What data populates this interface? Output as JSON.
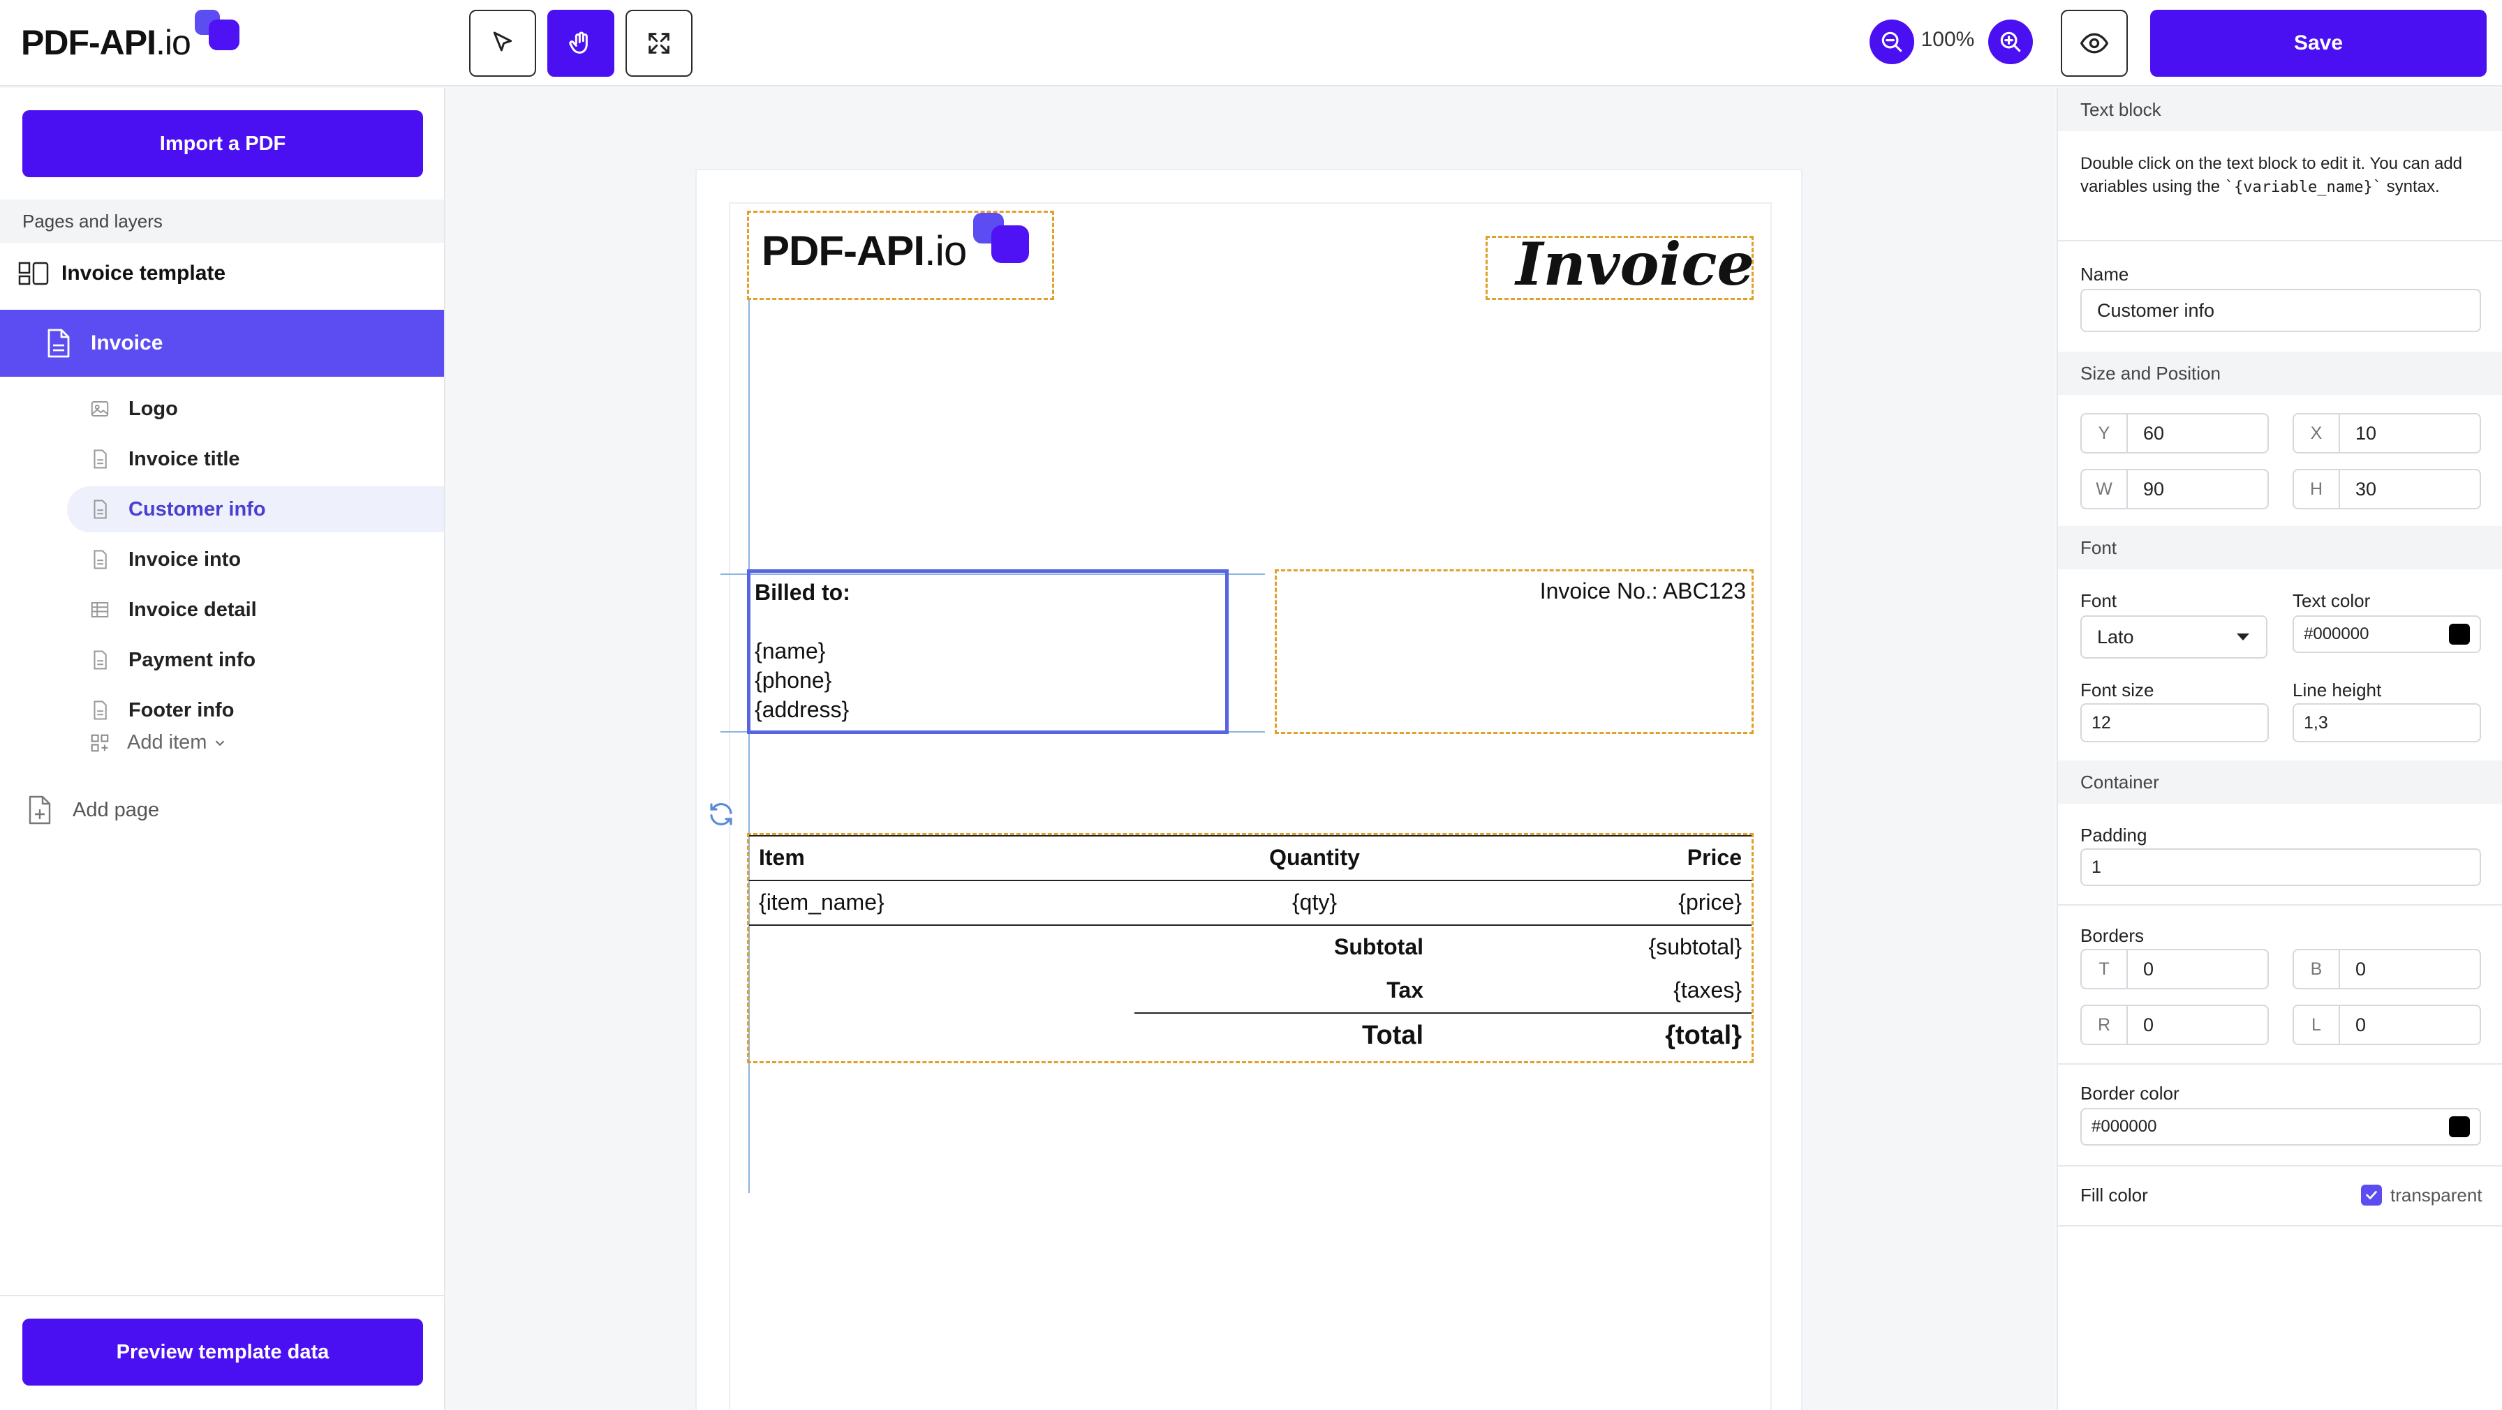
{
  "app": {
    "logo_text": "PDF-API",
    "logo_suffix": ".io"
  },
  "toolbar": {
    "tools": [
      {
        "name": "select",
        "icon": "cursor-icon",
        "active": false
      },
      {
        "name": "pan",
        "icon": "hand-icon",
        "active": true
      },
      {
        "name": "fit",
        "icon": "expand-icon",
        "active": false
      }
    ],
    "zoom_level": "100%",
    "save_label": "Save",
    "accent_color": "#4a10f2"
  },
  "sidebar": {
    "import_label": "Import a PDF",
    "section_title": "Pages and layers",
    "template_name": "Invoice template",
    "page_name": "Invoice",
    "layers": [
      {
        "label": "Logo",
        "icon": "image-icon",
        "selected": false
      },
      {
        "label": "Invoice title",
        "icon": "document-icon",
        "selected": false
      },
      {
        "label": "Customer info",
        "icon": "document-icon",
        "selected": true
      },
      {
        "label": "Invoice into",
        "icon": "document-icon",
        "selected": false
      },
      {
        "label": "Invoice detail",
        "icon": "table-icon",
        "selected": false
      },
      {
        "label": "Payment info",
        "icon": "document-icon",
        "selected": false
      },
      {
        "label": "Footer info",
        "icon": "document-icon",
        "selected": false
      }
    ],
    "add_item_label": "Add item",
    "add_page_label": "Add page",
    "preview_label": "Preview template data"
  },
  "document": {
    "logo_text": "PDF-API",
    "logo_suffix": ".io",
    "title": "Invoice",
    "billed_to_heading": "Billed to:",
    "billed_to_lines": [
      "{name}",
      "{phone}",
      "{address}"
    ],
    "invoice_no": "Invoice No.: ABC123",
    "table": {
      "headers": [
        "Item",
        "Quantity",
        "Price"
      ],
      "row": [
        "{item_name}",
        "{qty}",
        "{price}"
      ],
      "subtotal_label": "Subtotal",
      "subtotal_value": "{subtotal}",
      "tax_label": "Tax",
      "tax_value": "{taxes}",
      "total_label": "Total",
      "total_value": "{total}"
    }
  },
  "properties": {
    "section_text_block": "Text block",
    "help_text_1": "Double click on the text block to edit it. You can add variables using the ",
    "help_code": "`{variable_name}`",
    "help_text_2": " syntax.",
    "name_label": "Name",
    "name_value": "Customer info",
    "section_size": "Size and Position",
    "y_label": "Y",
    "y_value": "60",
    "x_label": "X",
    "x_value": "10",
    "w_label": "W",
    "w_value": "90",
    "h_label": "H",
    "h_value": "30",
    "section_font": "Font",
    "font_label": "Font",
    "font_value": "Lato",
    "text_color_label": "Text color",
    "text_color_value": "#000000",
    "font_size_label": "Font size",
    "font_size_value": "12",
    "line_height_label": "Line height",
    "line_height_value": "1,3",
    "section_container": "Container",
    "padding_label": "Padding",
    "padding_value": "1",
    "borders_label": "Borders",
    "border_t_label": "T",
    "border_t_value": "0",
    "border_b_label": "B",
    "border_b_value": "0",
    "border_r_label": "R",
    "border_r_value": "0",
    "border_l_label": "L",
    "border_l_value": "0",
    "border_color_label": "Border color",
    "border_color_value": "#000000",
    "fill_color_label": "Fill color",
    "fill_transparent_label": "transparent",
    "fill_transparent_checked": true
  }
}
